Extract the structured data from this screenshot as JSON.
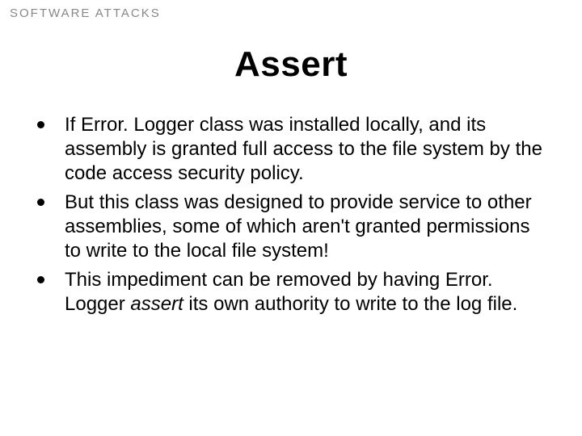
{
  "header": {
    "label": "Software Attacks"
  },
  "title": "Assert",
  "bullets": [
    {
      "parts": [
        {
          "text": "If Error. Logger class was installed locally, and its assembly is granted full access to the file system by the code access security policy.",
          "italic": false
        }
      ]
    },
    {
      "parts": [
        {
          "text": "But this class was designed to provide service to other assemblies, some of which aren't granted permissions to write to the local file system!",
          "italic": false
        }
      ]
    },
    {
      "parts": [
        {
          "text": "This impediment can be removed by having Error. Logger ",
          "italic": false
        },
        {
          "text": "assert",
          "italic": true
        },
        {
          "text": " its own authority to write to the log file.",
          "italic": false
        }
      ]
    }
  ]
}
